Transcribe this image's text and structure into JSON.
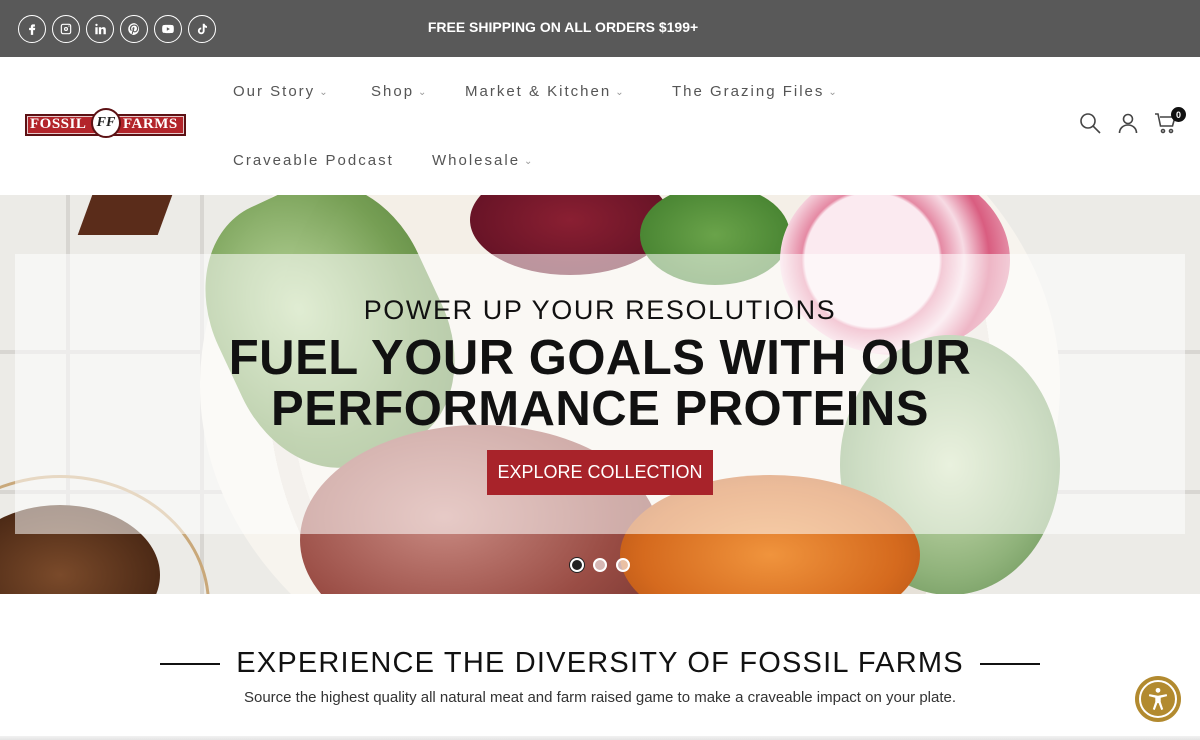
{
  "topbar": {
    "social_icons": [
      "facebook-icon",
      "instagram-icon",
      "linkedin-icon",
      "pinterest-icon",
      "youtube-icon",
      "tiktok-icon"
    ],
    "promo_text": "FREE SHIPPING ON ALL ORDERS $199+"
  },
  "header": {
    "logo": {
      "word1": "FOSSIL",
      "word2": "FARMS",
      "monogram": "FF"
    },
    "nav": [
      {
        "label": "Our Story",
        "has_dropdown": true
      },
      {
        "label": "Shop",
        "has_dropdown": true
      },
      {
        "label": "Market & Kitchen",
        "has_dropdown": true
      },
      {
        "label": "The Grazing Files",
        "has_dropdown": true
      },
      {
        "label": "Craveable Podcast",
        "has_dropdown": false
      },
      {
        "label": "Wholesale",
        "has_dropdown": true
      }
    ],
    "icons": [
      "search-icon",
      "account-icon",
      "cart-icon"
    ],
    "cart_count": "0"
  },
  "hero": {
    "subtitle": "POWER UP YOUR RESOLUTIONS",
    "title_line1": "FUEL YOUR GOALS WITH OUR",
    "title_line2": "PERFORMANCE PROTEINS",
    "button_label": "EXPLORE COLLECTION",
    "slides_total": 3,
    "active_slide": 1,
    "colors": {
      "button": "#a8232a"
    }
  },
  "section": {
    "title": "EXPERIENCE THE DIVERSITY OF FOSSIL FARMS",
    "description": "Source the highest quality all natural meat and farm raised game to make a craveable impact on your plate."
  },
  "accessibility": {
    "icon": "accessibility-icon",
    "color": "#b28a2f"
  },
  "colors": {
    "topbar": "#595959",
    "brand_red": "#b3252b"
  }
}
